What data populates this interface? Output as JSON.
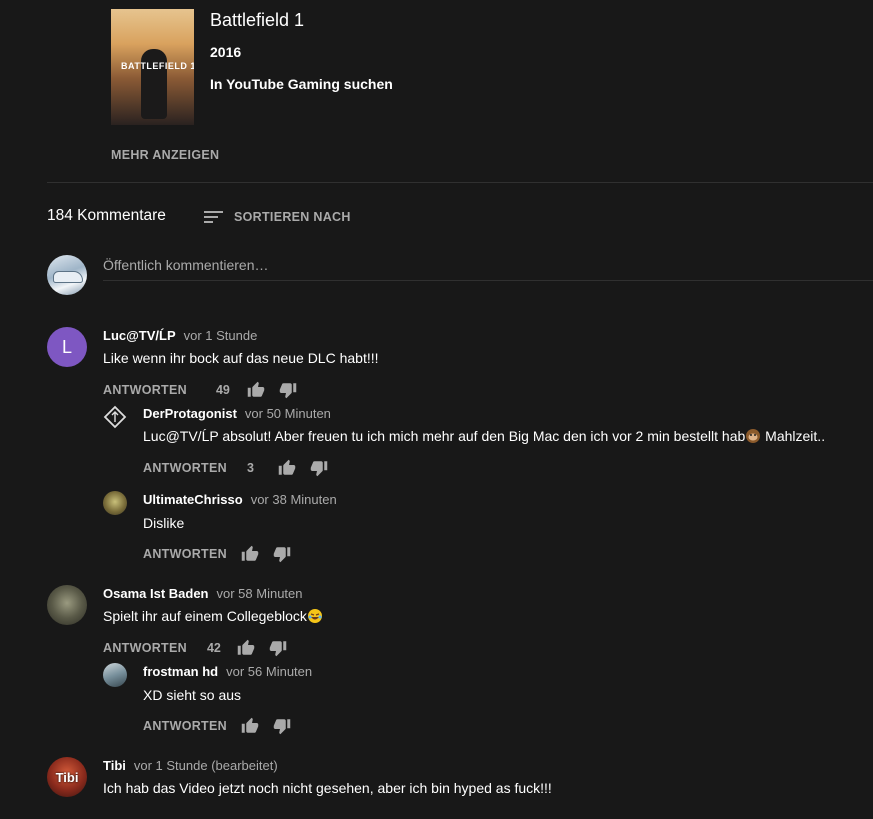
{
  "game": {
    "title": "Battlefield 1",
    "year": "2016",
    "search_link": "In YouTube Gaming suchen",
    "art_logo": "BATTLEFIELD 1"
  },
  "show_more": "MEHR ANZEIGEN",
  "comments_header": {
    "count": "184 Kommentare",
    "sort_label": "SORTIEREN NACH"
  },
  "new_comment": {
    "placeholder": "Öffentlich kommentieren…"
  },
  "actions": {
    "reply_label": "ANTWORTEN"
  },
  "comments": [
    {
      "avatar_letter": "L",
      "author": "Luc@TV/ĹP",
      "time": "vor 1 Stunde",
      "text": "Like wenn ihr bock auf das neue DLC habt!!!",
      "likes": "49",
      "replies": [
        {
          "author": "DerProtagonist",
          "time": "vor 50 Minuten",
          "text": "Luc@TV/ĹP absolut! Aber freuen tu ich mich mehr auf den Big Mac den ich vor 2 min bestellt hab",
          "text_end": " Mahlzeit..",
          "likes": "3"
        },
        {
          "author": "UltimateChrisso",
          "time": "vor 38 Minuten",
          "text": "Dislike",
          "likes": ""
        }
      ]
    },
    {
      "author": "Osama Ist Baden",
      "time": "vor 58 Minuten",
      "text": "Spielt ihr auf einem Collegeblock",
      "likes": "42",
      "replies": [
        {
          "author": "frostman hd",
          "time": "vor 56 Minuten",
          "text": "XD sieht so aus",
          "likes": ""
        }
      ]
    },
    {
      "author": "Tibi",
      "time": "vor 1 Stunde (bearbeitet)",
      "text": "Ich hab das Video jetzt noch nicht gesehen, aber ich bin hyped as fuck!!!",
      "avatar_text": "Tibi"
    }
  ]
}
